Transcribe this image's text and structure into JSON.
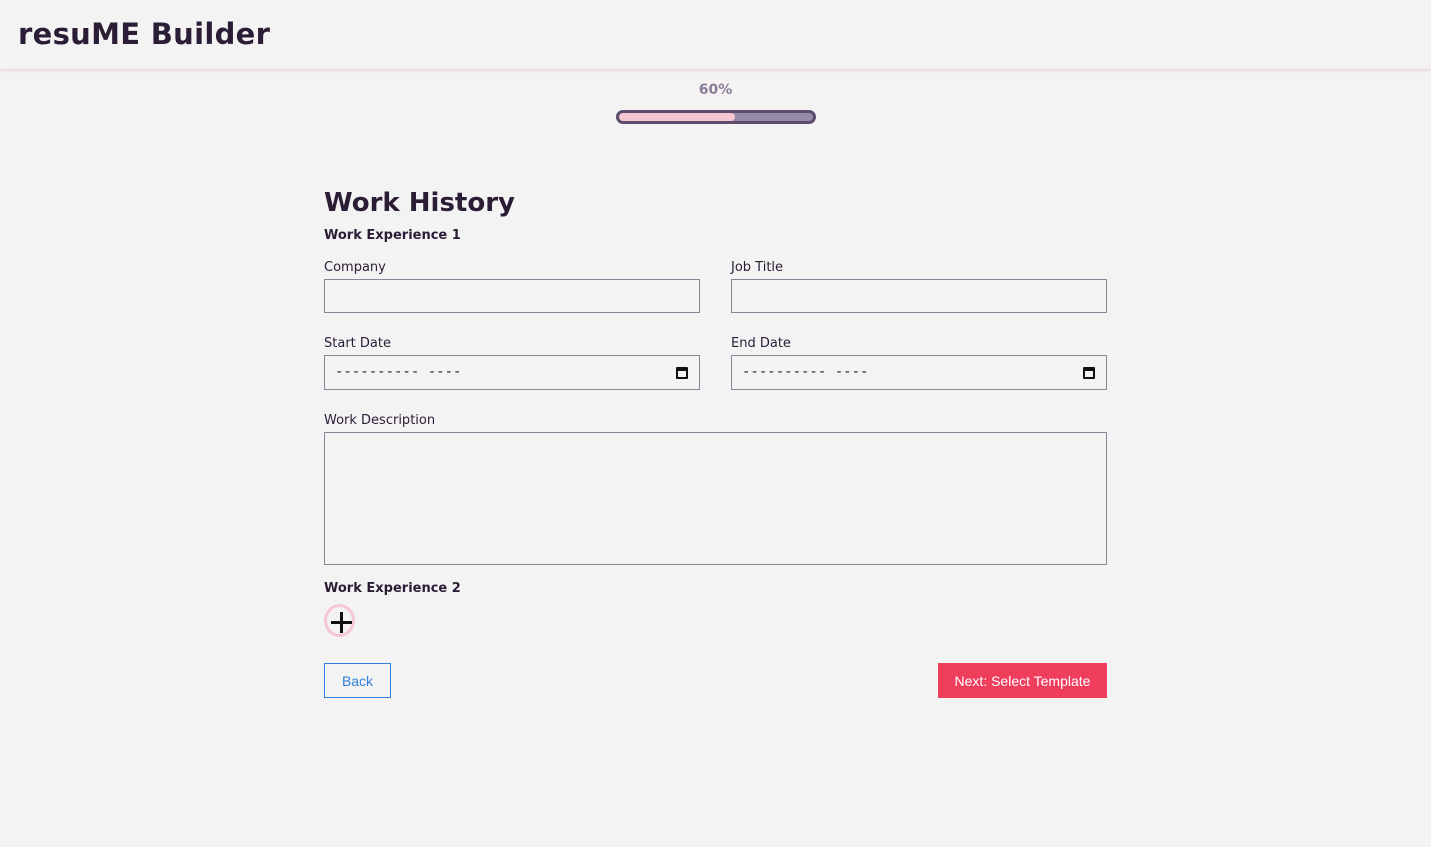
{
  "header": {
    "brand": "resuME Builder"
  },
  "progress": {
    "label": "60%",
    "value": 60
  },
  "page": {
    "title": "Work History"
  },
  "experience1": {
    "title": "Work Experience 1",
    "company": {
      "label": "Company",
      "value": ""
    },
    "job_title": {
      "label": "Job Title",
      "value": ""
    },
    "start_date": {
      "label": "Start Date",
      "display": "---------- ----"
    },
    "end_date": {
      "label": "End Date",
      "display": "---------- ----"
    },
    "description": {
      "label": "Work Description",
      "value": ""
    }
  },
  "experience2": {
    "title": "Work Experience 2"
  },
  "actions": {
    "back_label": "Back",
    "next_label": "Next: Select Template"
  },
  "colors": {
    "accent": "#ef3e5c",
    "progress_fill": "#f7c6d4",
    "progress_track": "#968ba6",
    "link_blue": "#2f7fd8",
    "text_dark": "#2a1d35"
  },
  "icons": {
    "add": "plus-icon",
    "calendar": "calendar-icon"
  }
}
